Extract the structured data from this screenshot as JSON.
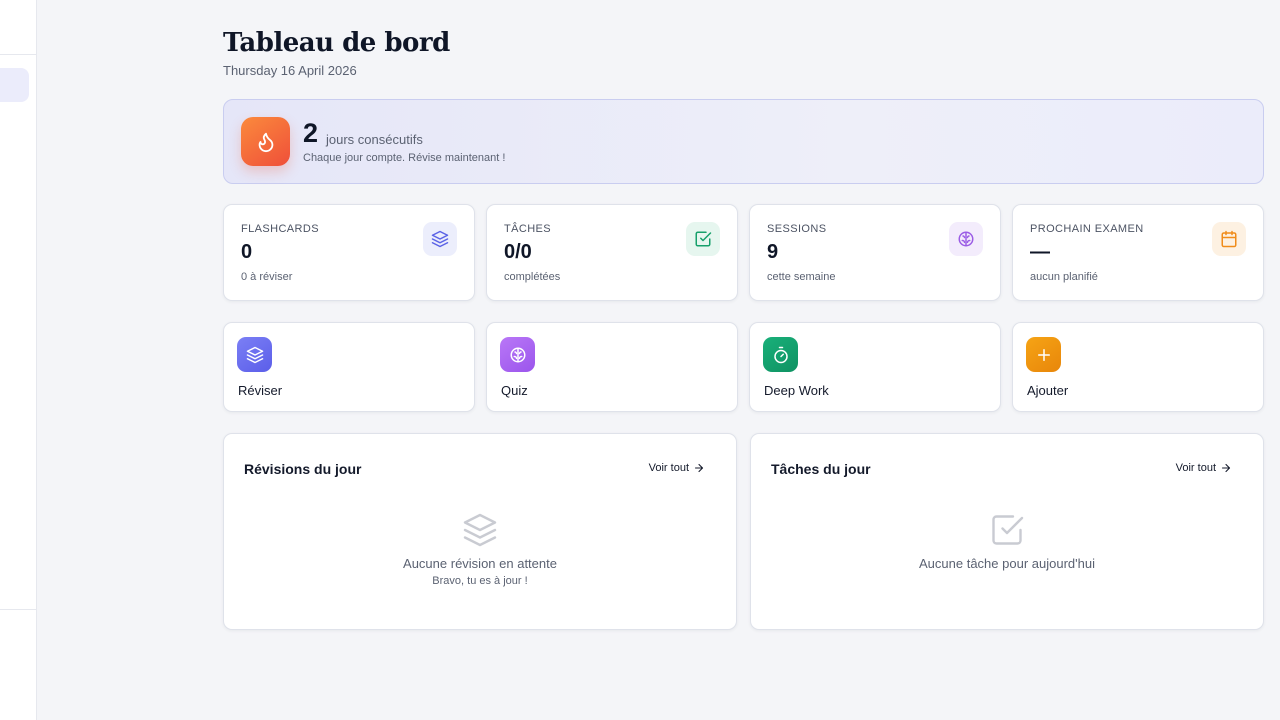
{
  "header": {
    "title": "Tableau de bord",
    "date": "Thursday 16 April 2026"
  },
  "streak": {
    "count": "2",
    "label": "jours consécutifs",
    "subtitle": "Chaque jour compte. Révise maintenant !",
    "icon": "flame-icon"
  },
  "stats": [
    {
      "label": "FLASHCARDS",
      "value": "0",
      "sub": "0 à réviser",
      "icon": "layers-icon",
      "color": "#5b63e6"
    },
    {
      "label": "TÂCHES",
      "value": "0/0",
      "sub": "complétées",
      "icon": "check-square-icon",
      "color": "#17a06b"
    },
    {
      "label": "SESSIONS",
      "value": "9",
      "sub": "cette semaine",
      "icon": "brain-icon",
      "color": "#9b5de5"
    },
    {
      "label": "PROCHAIN EXAMEN",
      "value": "—",
      "sub": "aucun planifié",
      "icon": "calendar-icon",
      "color": "#f08c1a"
    }
  ],
  "actions": [
    {
      "label": "Réviser",
      "icon": "layers-icon",
      "color": "#6366f1"
    },
    {
      "label": "Quiz",
      "icon": "brain-icon",
      "color": "#a855f7"
    },
    {
      "label": "Deep Work",
      "icon": "timer-icon",
      "color": "#10a06a"
    },
    {
      "label": "Ajouter",
      "icon": "plus-icon",
      "color": "#f59e0b"
    }
  ],
  "panels": [
    {
      "title": "Révisions du jour",
      "link": "Voir tout",
      "empty_text": "Aucune révision en attente",
      "empty_sub": "Bravo, tu es à jour !",
      "icon": "layers-icon"
    },
    {
      "title": "Tâches du jour",
      "link": "Voir tout",
      "empty_text": "Aucune tâche pour aujourd'hui",
      "icon": "check-square-icon"
    }
  ]
}
